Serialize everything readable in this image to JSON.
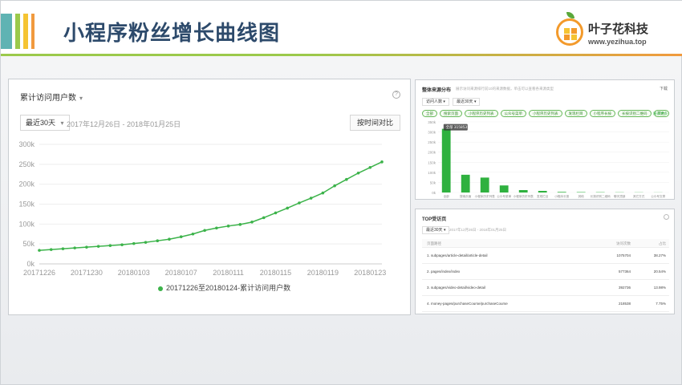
{
  "header": {
    "title": "小程序粉丝增长曲线图",
    "logo_name": "叶子花科技",
    "logo_url": "www.yezihua.top",
    "stripes": [
      "#5fb3b3",
      "#9bc94b",
      "#f5c433",
      "#f19a3e"
    ]
  },
  "main": {
    "heading": "累计访问用户数",
    "range_select": "最近30天",
    "date_range": "2017年12月26日 - 2018年01月25日",
    "compare_button": "按时间对比",
    "legend": "20171226至20180124-累计访问用户数",
    "chart_data": {
      "type": "line",
      "x": [
        "20171226",
        "20171227",
        "20171228",
        "20171229",
        "20171230",
        "20171231",
        "20180101",
        "20180102",
        "20180103",
        "20180104",
        "20180105",
        "20180106",
        "20180107",
        "20180108",
        "20180109",
        "20180110",
        "20180111",
        "20180112",
        "20180113",
        "20180114",
        "20180115",
        "20180116",
        "20180117",
        "20180118",
        "20180119",
        "20180120",
        "20180121",
        "20180122",
        "20180123",
        "20180124"
      ],
      "x_tick_labels": [
        "20171226",
        "20171230",
        "20180103",
        "20180107",
        "20180111",
        "20180115",
        "20180119",
        "20180123"
      ],
      "y_tick_labels": [
        "0k",
        "50k",
        "100k",
        "150k",
        "200k",
        "250k",
        "300k"
      ],
      "ylim": [
        0,
        300000
      ],
      "series": [
        {
          "name": "20171226至20180124-累计访问用户数",
          "color": "#3cb34a",
          "values": [
            34000,
            36000,
            38000,
            40000,
            42000,
            44000,
            46000,
            48000,
            51000,
            54000,
            58000,
            62000,
            68000,
            75000,
            84000,
            90000,
            95000,
            99000,
            105000,
            116000,
            128000,
            140000,
            153000,
            165000,
            178000,
            196000,
            212000,
            228000,
            242000,
            256000
          ]
        }
      ]
    }
  },
  "source_panel": {
    "title": "整体来源分布",
    "description": "展示访问来源排行前10的来源数据，单击可以查看各来源类型",
    "download": "下载",
    "select_metric": "访问人数",
    "select_range": "最近30天",
    "pills": [
      "全部",
      "搜索页面",
      "小程序历史列表",
      "公众号菜单",
      "小程序历史列表",
      "发现栏目",
      "小程序长按",
      "长按识别二维码",
      "其他"
    ],
    "more_link": "展开更多",
    "tooltip": "全部 315853",
    "chart_data": {
      "type": "bar",
      "categories": [
        "全部",
        "搜索页面",
        "小程序历史列表",
        "公众号菜单",
        "小程序历史列表",
        "发现栏目",
        "小程序长按",
        "其他",
        "长按识别二维码",
        "聊天顶部",
        "其它方式",
        "公众号文章"
      ],
      "values": [
        315853,
        88000,
        74000,
        35000,
        12000,
        8000,
        3000,
        2000,
        1500,
        1000,
        800,
        500
      ],
      "ylim": [
        0,
        350000
      ],
      "y_tick_labels": [
        "0k",
        "50k",
        "100k",
        "150k",
        "200k",
        "250k",
        "300k",
        "350k"
      ],
      "color": "#2fb13f"
    }
  },
  "top_pages": {
    "title": "TOP受访页",
    "range_select": "最近30天",
    "date_range": "2017年12月26日 - 2018年01月25日",
    "columns": [
      "页面路径",
      "访问次数",
      "占比"
    ],
    "rows": [
      {
        "path": "1. subpages/article-detail/article-detail",
        "count": "1075704",
        "share": "38.27%"
      },
      {
        "path": "2. pages/index/index",
        "count": "577364",
        "share": "20.54%"
      },
      {
        "path": "3. subpages/video-detail/video-detail",
        "count": "392736",
        "share": "13.98%"
      },
      {
        "path": "4. money-pages/purchaseCourse/purchaseCourse",
        "count": "218538",
        "share": "7.75%"
      }
    ]
  }
}
